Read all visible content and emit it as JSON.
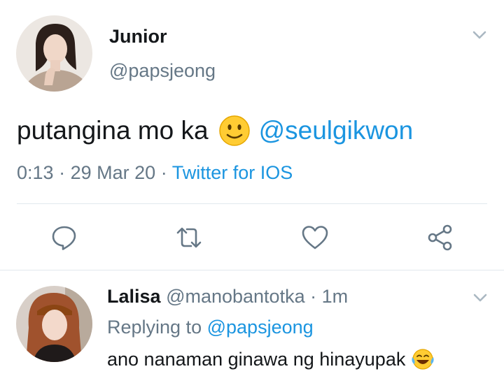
{
  "tweet": {
    "display_name": "Junior",
    "handle": "@papsjeong",
    "text": "putangina mo ka",
    "emoji": "slightly-smiling-face-emoji",
    "mention": "@seulgikwon",
    "time": "0:13",
    "date": "29 Mar 20",
    "source": "Twitter for IOS",
    "separator": "·"
  },
  "actions": [
    {
      "icon": "reply-icon"
    },
    {
      "icon": "retweet-icon"
    },
    {
      "icon": "like-icon"
    },
    {
      "icon": "share-icon"
    }
  ],
  "reply": {
    "display_name": "Lalisa",
    "handle": "@manobantotka",
    "separator": "·",
    "age": "1m",
    "replying_prefix": "Replying to",
    "replying_handle": "@papsjeong",
    "text": "ano nanaman ginawa ng hinayupak",
    "emoji": "face-with-tears-of-joy-emoji"
  },
  "colors": {
    "link": "#1b95e0",
    "secondary": "#657786",
    "divider": "#e1e8ed",
    "text": "#14171a",
    "icon": "#657786"
  }
}
